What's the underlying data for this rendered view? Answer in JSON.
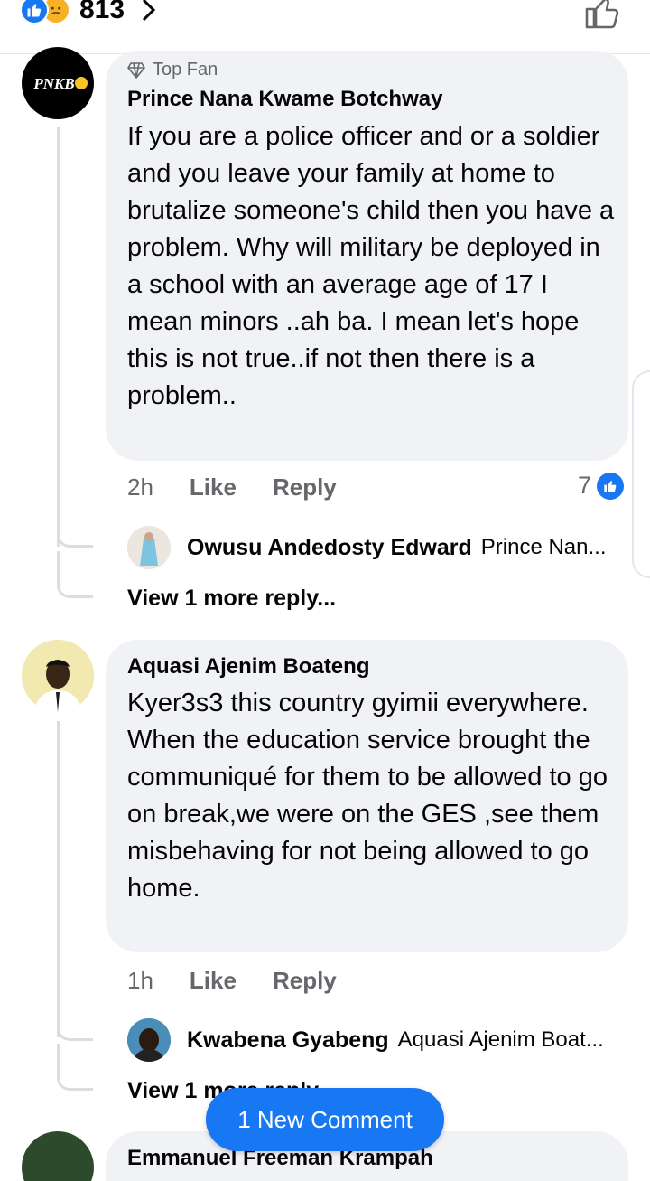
{
  "reactions": {
    "count": "813",
    "types": [
      "like-icon",
      "sad-icon"
    ]
  },
  "comments": [
    {
      "badge": "Top Fan",
      "author": "Prince Nana Kwame Botchway",
      "avatar_text": "PNKB",
      "text": "If you are a police officer and or a soldier and you leave your family at home to brutalize someone's child then you have a problem. Why will military be deployed in a school with an average age of 17 I mean minors ..ah ba. I mean let's hope this is not true..if not then there is a problem..",
      "time": "2h",
      "like_label": "Like",
      "reply_label": "Reply",
      "reaction_count": "7",
      "reply_preview": {
        "author": "Owusu Andedosty Edward",
        "snippet": "Prince Nan..."
      },
      "view_more": "View 1 more reply..."
    },
    {
      "author": "Aquasi Ajenim Boateng",
      "text": "Kyer3s3 this country gyimii everywhere. When the education service brought the communiqué for them to be allowed to go on break,we were on the GES ,see them misbehaving for not being allowed to go home.",
      "time": "1h",
      "like_label": "Like",
      "reply_label": "Reply",
      "reply_preview": {
        "author": "Kwabena Gyabeng",
        "snippet": "Aquasi Ajenim Boat..."
      },
      "view_more": "View 1 more reply..."
    },
    {
      "author": "Emmanuel Freeman Krampah"
    }
  ],
  "new_comment_button": "1 New Comment",
  "colors": {
    "accent": "#1877f2",
    "bubble": "#f0f2f5",
    "muted": "#65676b"
  }
}
